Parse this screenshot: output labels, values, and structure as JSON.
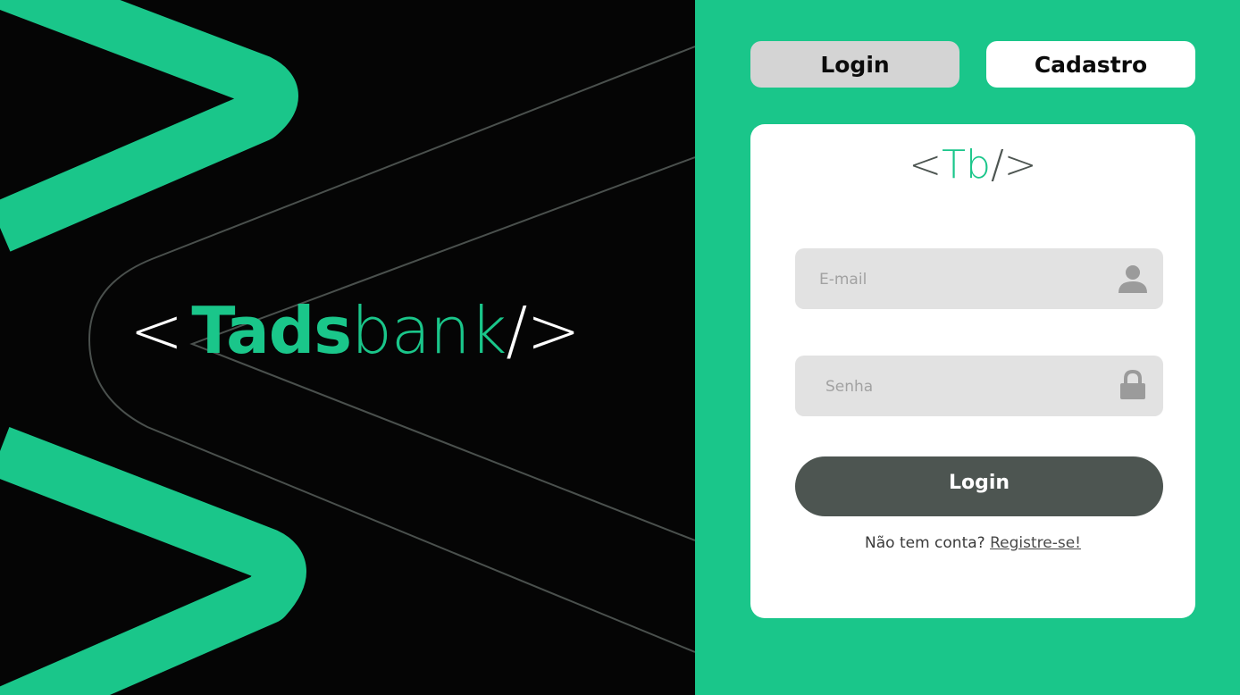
{
  "brand": {
    "logo_open": "<",
    "logo_tads": "Tads",
    "logo_bank": "bank",
    "logo_close": "/>"
  },
  "tabs": {
    "login_label": "Login",
    "cadastro_label": "Cadastro"
  },
  "card": {
    "logo_open": "<",
    "logo_tb": "Tb",
    "logo_close": "/>",
    "email_placeholder": "E-mail",
    "email_icon": "user-icon",
    "senha_placeholder": "Senha",
    "senha_icon": "lock-icon",
    "login_button": "Login",
    "register_prompt": "Não tem conta?",
    "register_link": "Registre-se!"
  },
  "colors": {
    "accent": "#1ac68a",
    "dark_background": "#050505",
    "button_dark": "#4d5551",
    "field_background": "#e2e2e2",
    "tab_active": "#d4d4d4",
    "tab_inactive": "#ffffff"
  }
}
